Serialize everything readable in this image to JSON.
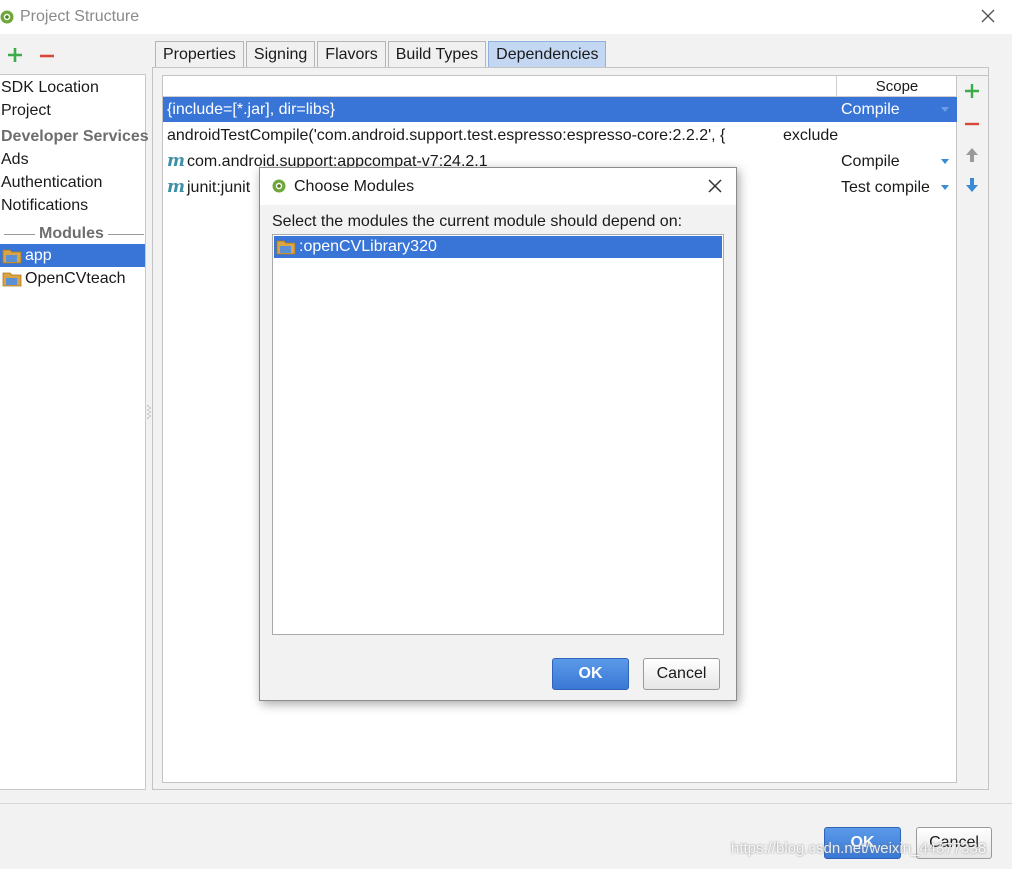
{
  "window": {
    "title": "Project Structure"
  },
  "sidebar": {
    "items": [
      "SDK Location",
      "Project"
    ],
    "developer_services_header": "Developer Services",
    "services": [
      "Ads",
      "Authentication",
      "Notifications"
    ],
    "modules_header": "Modules",
    "modules": [
      {
        "label": "app",
        "selected": true
      },
      {
        "label": "OpenCVteach",
        "selected": false
      }
    ]
  },
  "tabs": [
    {
      "label": "Properties",
      "active": false
    },
    {
      "label": "Signing",
      "active": false
    },
    {
      "label": "Flavors",
      "active": false
    },
    {
      "label": "Build Types",
      "active": false
    },
    {
      "label": "Dependencies",
      "active": true
    }
  ],
  "dependencies": {
    "scope_header": "Scope",
    "rows": [
      {
        "dep": "{include=[*.jar], dir=libs}",
        "scope": "Compile",
        "selected": true,
        "icon": "",
        "dropdown": true
      },
      {
        "dep": "androidTestCompile('com.android.support.test.espresso:espresso-core:2.2.2', {",
        "scope": "exclude",
        "selected": false,
        "icon": "",
        "dropdown": false
      },
      {
        "dep": "com.android.support:appcompat-v7:24.2.1",
        "scope": "Compile",
        "selected": false,
        "icon": "m",
        "dropdown": true
      },
      {
        "dep": "junit:junit",
        "scope": "Test compile",
        "selected": false,
        "icon": "m",
        "dropdown": true
      }
    ]
  },
  "dialog": {
    "title": "Choose Modules",
    "prompt": "Select the modules the current module should depend on:",
    "modules": [
      ":openCVLibrary320"
    ],
    "ok_label": "OK",
    "cancel_label": "Cancel"
  },
  "footer": {
    "ok_label": "OK",
    "cancel_label": "Cancel"
  },
  "watermark": "https://blog.csdn.net/weixin_44377338",
  "colors": {
    "selection": "#3875d7",
    "add": "#3dab4a",
    "remove": "#d9473a",
    "arrow_down": "#3a8ad4",
    "arrow_up": "#9a9a9a"
  }
}
